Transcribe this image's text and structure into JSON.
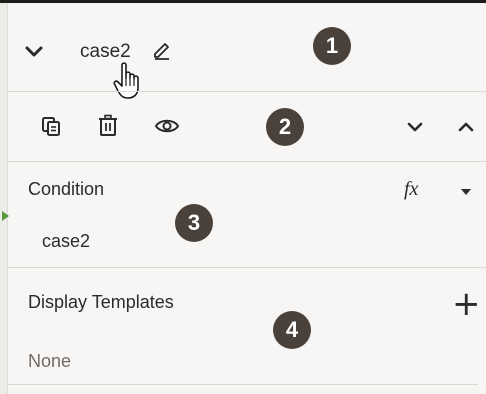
{
  "header": {
    "title": "case2",
    "collapse_icon": "chevron-down-icon",
    "edit_icon": "pencil-icon"
  },
  "toolbar": {
    "icons": [
      "duplicate-icon",
      "trash-icon",
      "eye-icon",
      "chevron-down-icon",
      "chevron-up-icon"
    ]
  },
  "condition": {
    "label": "Condition",
    "fx": "fx",
    "value": "case2"
  },
  "display_templates": {
    "label": "Display Templates",
    "add": "+",
    "value": "None"
  },
  "callouts": [
    "1",
    "2",
    "3",
    "4"
  ],
  "colors": {
    "badge": "#4a413b",
    "indicator": "#5a9a3a",
    "background": "#f7f6f4"
  }
}
